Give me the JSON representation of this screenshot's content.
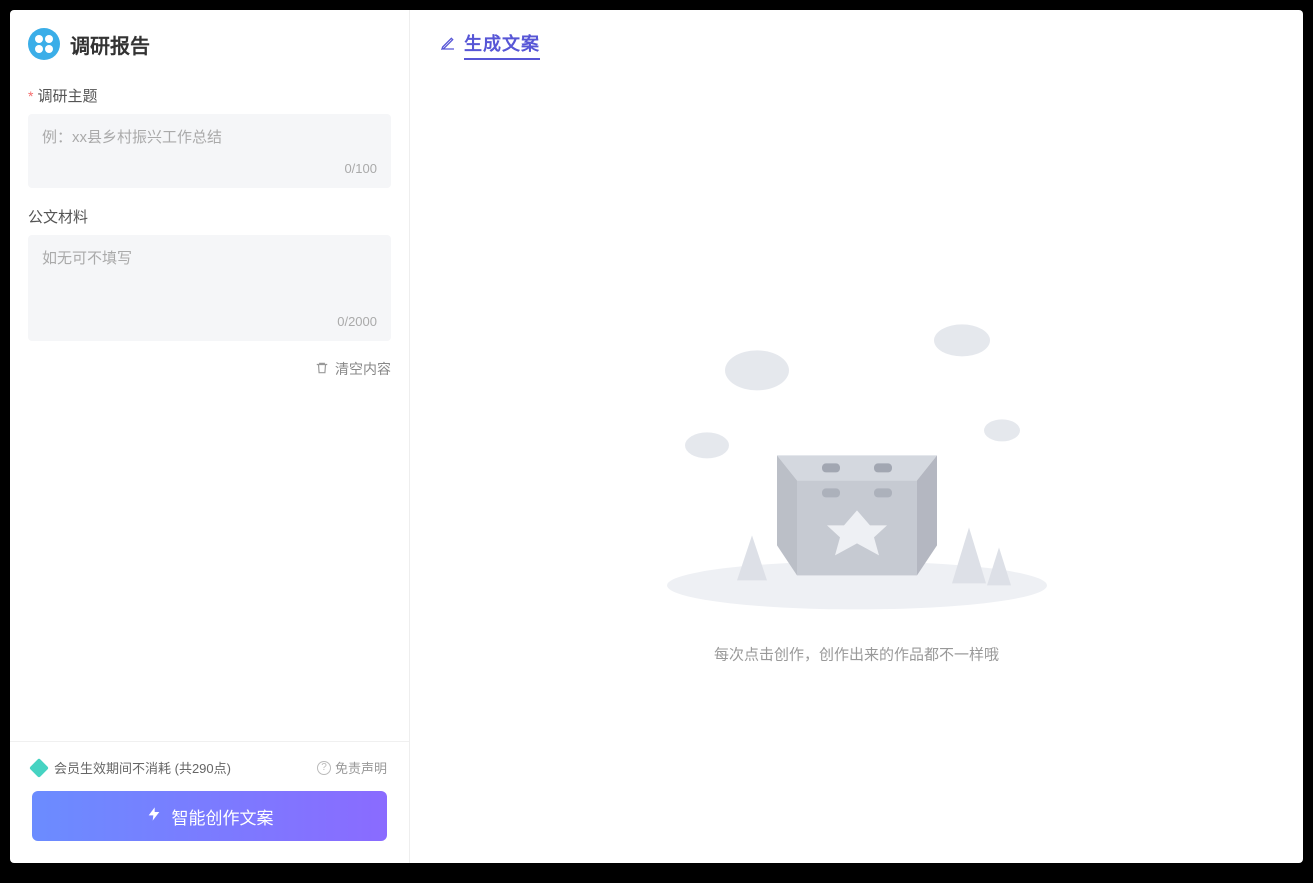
{
  "header": {
    "title": "调研报告"
  },
  "form": {
    "topic": {
      "label": "调研主题",
      "required_marker": "*",
      "placeholder": "例：xx县乡村振兴工作总结",
      "value": "",
      "counter": "0/100"
    },
    "material": {
      "label": "公文材料",
      "placeholder": "如无可不填写",
      "value": "",
      "counter": "0/2000"
    },
    "clear_label": "清空内容"
  },
  "footer": {
    "credits_text": "会员生效期间不消耗 (共290点)",
    "disclaimer_label": "免责声明",
    "generate_button_label": "智能创作文案"
  },
  "right": {
    "title": "生成文案",
    "empty_text": "每次点击创作，创作出来的作品都不一样哦"
  }
}
